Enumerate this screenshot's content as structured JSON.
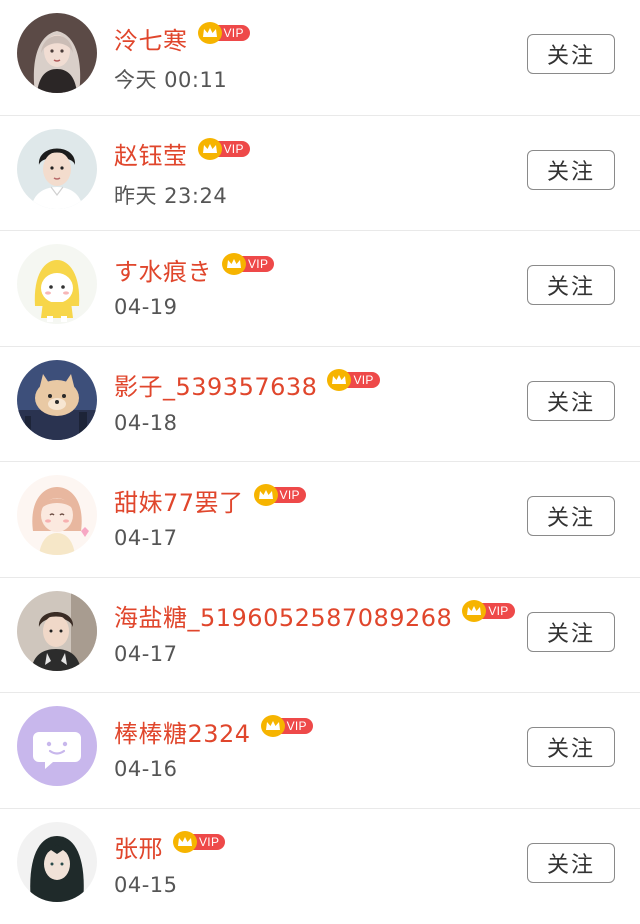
{
  "vip_badge_label": "VIP",
  "colors": {
    "name": "#e0462c",
    "vip_pill": "#ee4949",
    "vip_crown": "#f6b400",
    "time": "#555555",
    "button_border": "#8a8a8a"
  },
  "follow_label": "关注",
  "users": [
    {
      "name": "泠七寒",
      "time": "今天 00:11",
      "avatar_icon": "anime-girl-avatar"
    },
    {
      "name": "赵钰莹",
      "time": "昨天 23:24",
      "avatar_icon": "young-man-portrait-avatar"
    },
    {
      "name": "す水痕き",
      "time": "04-19",
      "avatar_icon": "yellow-raincoat-cartoon-avatar"
    },
    {
      "name": "影子_539357638",
      "time": "04-18",
      "avatar_icon": "dog-cloud-avatar"
    },
    {
      "name": "甜妹77罢了",
      "time": "04-17",
      "avatar_icon": "cartoon-girl-avatar"
    },
    {
      "name": "海盐糖_5196052587089268",
      "time": "04-17",
      "avatar_icon": "young-man-photo-avatar"
    },
    {
      "name": "棒棒糖2324",
      "time": "04-16",
      "avatar_icon": "chat-bubble-default-avatar"
    },
    {
      "name": "张邢",
      "time": "04-15",
      "avatar_icon": "anime-character-avatar"
    }
  ]
}
